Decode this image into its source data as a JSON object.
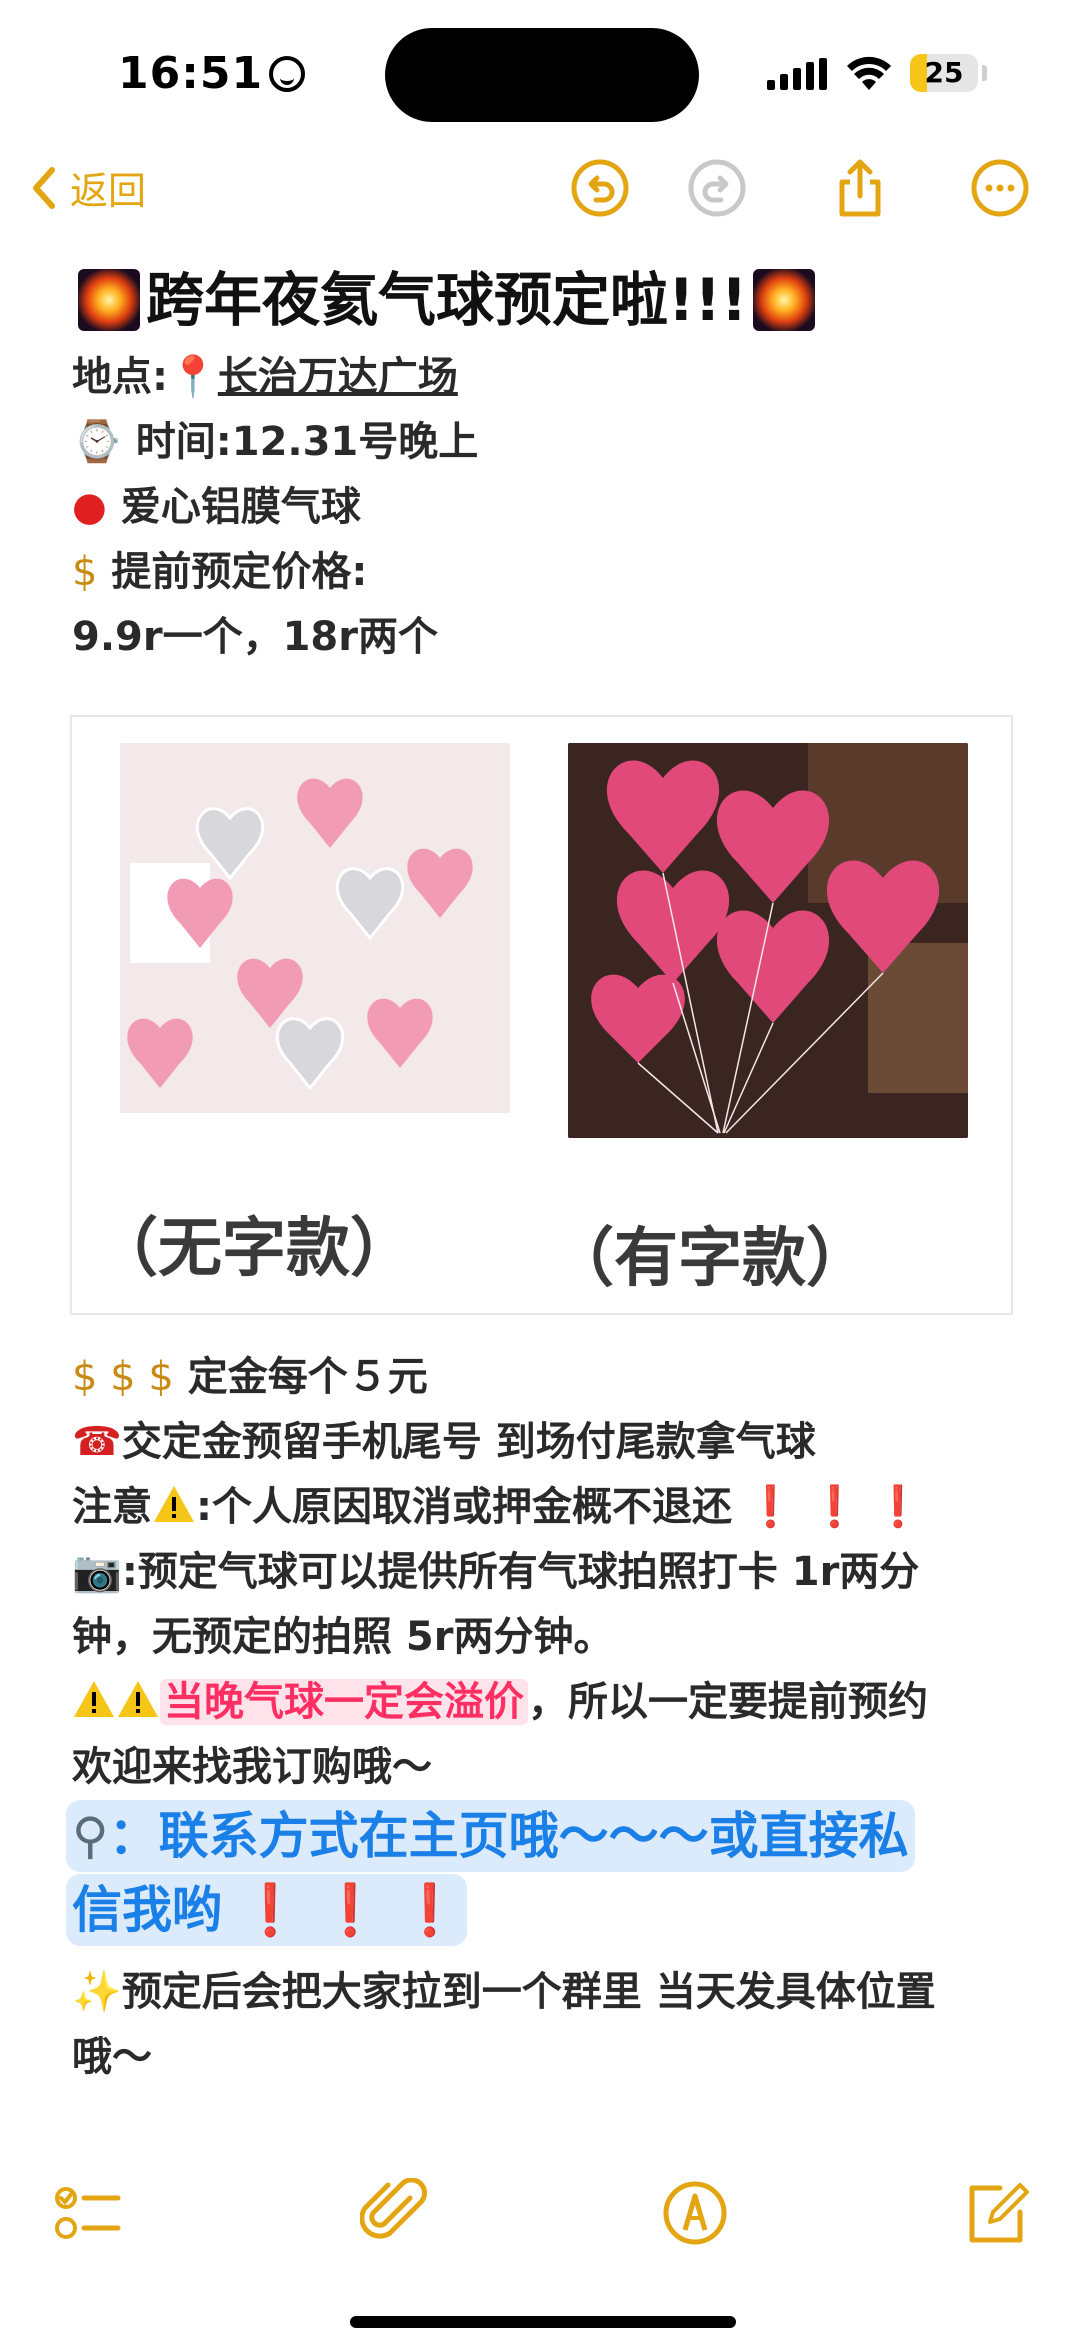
{
  "status_bar": {
    "time": "16:51",
    "battery": "25",
    "battery_level": 0.25
  },
  "nav": {
    "back_label": "返回"
  },
  "note": {
    "title": "跨年夜氦气球预定啦!!!",
    "location_label": "地点:",
    "location_value": "长治万达广场",
    "time_line": "时间:12.31号晚上",
    "item_line": "爱心铝膜气球",
    "price_label": "提前预定价格:",
    "price_value": "9.9r一个，18r两个",
    "caption_left": "（无字款）",
    "caption_right": "（有字款）",
    "deposit_line": "定金每个５元",
    "phone_line": "交定金预留手机尾号 到场付尾款拿气球",
    "notice_prefix": "注意",
    "notice_text": ":个人原因取消或押金概不退还",
    "photo_line1": ":预定气球可以提供所有气球拍照打卡 1r两分",
    "photo_line2": "钟，无预定的拍照 5r两分钟。",
    "price_warn_highlight": "当晚气球一定会溢价",
    "price_warn_rest": "，所以一定要提前预约",
    "welcome_line": "欢迎来找我订购哦～",
    "contact_line1": "：联系方式在主页哦～～～或直接私",
    "contact_line2": "信我哟",
    "group_line1": "预定后会把大家拉到一个群里 当天发具体位置",
    "group_line2": "哦～"
  },
  "icons": {
    "back": "chevron-left-icon",
    "undo": "undo-icon",
    "redo": "redo-icon",
    "share": "share-icon",
    "more": "more-icon",
    "checklist": "checklist-icon",
    "attach": "paperclip-icon",
    "markup": "markup-pen-icon",
    "compose": "compose-icon"
  },
  "colors": {
    "accent": "#e3a612",
    "highlight_pink": "#ff2e63",
    "highlight_blue": "#1a7fe6",
    "red": "#e02020"
  }
}
